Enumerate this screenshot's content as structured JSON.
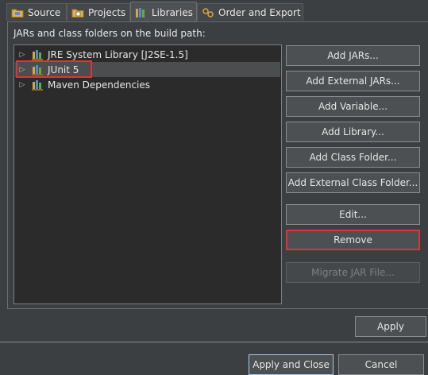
{
  "tabs": [
    {
      "label": "Source",
      "icon": "source-folder-icon"
    },
    {
      "label": "Projects",
      "icon": "projects-icon"
    },
    {
      "label": "Libraries",
      "icon": "libraries-icon",
      "active": true
    },
    {
      "label": "Order and Export",
      "icon": "order-export-icon"
    }
  ],
  "panel": {
    "caption": "JARs and class folders on the build path:",
    "tree": [
      {
        "label": "JRE System Library [J2SE-1.5]",
        "icon": "library-icon"
      },
      {
        "label": "JUnit 5",
        "icon": "library-icon",
        "selected": true
      },
      {
        "label": "Maven Dependencies",
        "icon": "library-icon"
      }
    ],
    "buttons": {
      "add_jars": "Add JARs...",
      "add_external_jars": "Add External JARs...",
      "add_variable": "Add Variable...",
      "add_library": "Add Library...",
      "add_class_folder": "Add Class Folder...",
      "add_external_class_folder": "Add External Class Folder...",
      "edit": "Edit...",
      "remove": "Remove",
      "migrate_jar": "Migrate JAR File..."
    }
  },
  "footer": {
    "apply": "Apply",
    "apply_and_close": "Apply and Close",
    "cancel": "Cancel"
  },
  "colors": {
    "background": "#3c3f41",
    "tree_background": "#2b2b2b",
    "highlight": "#e03333",
    "library_icon_books": [
      "#d9a441",
      "#4a8fd0",
      "#6aaa3a"
    ]
  }
}
